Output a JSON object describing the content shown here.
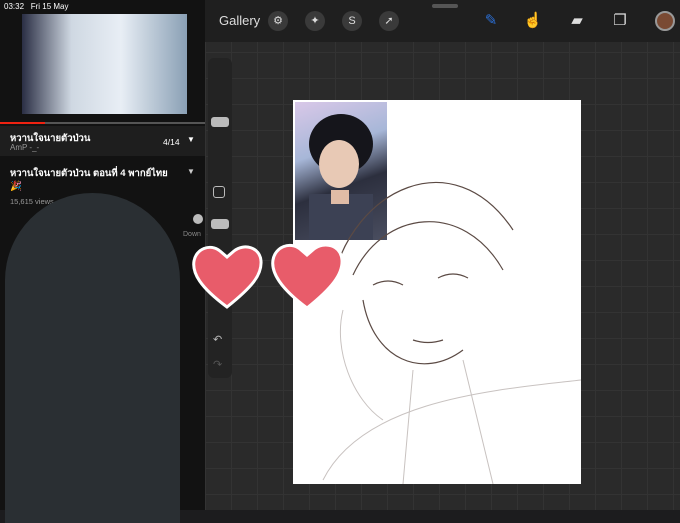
{
  "status": {
    "time": "03:32",
    "date": "Fri 15 May"
  },
  "youtube": {
    "playlist_title": "หวานใจนายตัวป่วน",
    "playlist_owner": "AmP -_-",
    "playlist_position": "4/14",
    "video_title": "หวานใจนายตัวป่วน ตอนที่ 4 พากย์ไทย",
    "video_emoji": "🎉",
    "views": "15,615 views",
    "download_label": "Down",
    "progress_fraction": 0.22
  },
  "procreate": {
    "gallery_label": "Gallery",
    "tools_left": [
      "wrench-icon",
      "magic-wand-icon",
      "selection-icon",
      "transform-arrow-icon"
    ],
    "tools_right": [
      "brush-icon",
      "smudge-icon",
      "eraser-icon",
      "layers-icon"
    ],
    "accent_color": "#2b6fd6",
    "current_color": "#7a4a33"
  },
  "decor": {
    "heart_color": "#e85c6a"
  }
}
